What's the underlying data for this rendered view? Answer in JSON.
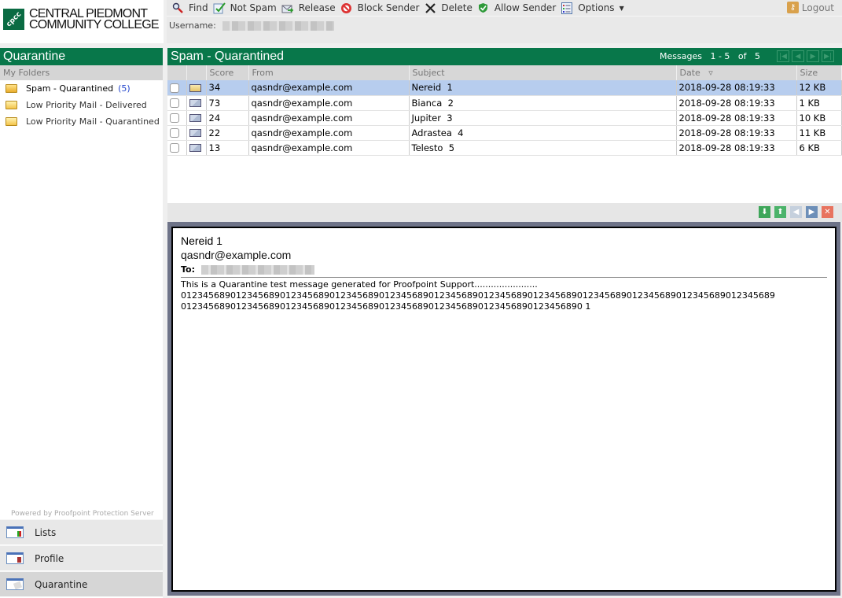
{
  "logo": {
    "mark": "cpcc",
    "line1": "CENTRAL PIEDMONT",
    "line2": "COMMUNITY COLLEGE"
  },
  "toolbar": {
    "buttons": [
      {
        "label": "Find",
        "icon": "magnifier-icon"
      },
      {
        "label": "Not Spam",
        "icon": "notepad-check-icon"
      },
      {
        "label": "Release",
        "icon": "envelope-arrow-icon"
      },
      {
        "label": "Block Sender",
        "icon": "block-icon"
      },
      {
        "label": "Delete",
        "icon": "x-icon"
      },
      {
        "label": "Allow Sender",
        "icon": "shield-check-icon"
      },
      {
        "label": "Options",
        "icon": "list-icon"
      }
    ],
    "logout": "Logout",
    "username_label": "Username:"
  },
  "sidebar": {
    "title": "Quarantine",
    "subtitle": "My Folders",
    "folders": [
      {
        "label": "Spam - Quarantined",
        "count": "(5)",
        "active": true
      },
      {
        "label": "Low Priority Mail - Delivered",
        "count": null,
        "active": false
      },
      {
        "label": "Low Priority Mail - Quarantined",
        "count": null,
        "active": false
      }
    ],
    "powered_by": "Powered by Proofpoint Protection Server",
    "nav": [
      {
        "label": "Lists"
      },
      {
        "label": "Profile"
      },
      {
        "label": "Quarantine"
      }
    ]
  },
  "main": {
    "title": "Spam - Quarantined",
    "messages_label": "Messages",
    "range": "1 - 5",
    "of": "of",
    "total": "5",
    "columns": [
      "",
      "",
      "Score",
      "From",
      "Subject",
      "Date",
      "Size"
    ],
    "sort_indicator": "▿",
    "rows": [
      {
        "score": "34",
        "from": "qasndr@example.com",
        "subject": "Nereid  1",
        "date": "2018-09-28 08:19:33",
        "size": "12 KB"
      },
      {
        "score": "73",
        "from": "qasndr@example.com",
        "subject": "Bianca  2",
        "date": "2018-09-28 08:19:33",
        "size": "1 KB"
      },
      {
        "score": "24",
        "from": "qasndr@example.com",
        "subject": "Jupiter  3",
        "date": "2018-09-28 08:19:33",
        "size": "10 KB"
      },
      {
        "score": "22",
        "from": "qasndr@example.com",
        "subject": "Adrastea  4",
        "date": "2018-09-28 08:19:33",
        "size": "11 KB"
      },
      {
        "score": "13",
        "from": "qasndr@example.com",
        "subject": "Telesto  5",
        "date": "2018-09-28 08:19:33",
        "size": "6 KB"
      }
    ]
  },
  "preview": {
    "subject": "Nereid  1",
    "from": "qasndr@example.com",
    "to_label": "To:",
    "body_line1": "This is a Quarantine test message generated for Proofpoint Support.......................",
    "body_line2": "012345689012345689012345689012345689012345689012345689012345689012345689012345689012345689012345689012345689",
    "body_line3": "0123456890123456890123456890123456890123456890123456890123456890123456890 1"
  },
  "colors": {
    "brand_green": "#08774a",
    "selected_row": "#b7cdee",
    "preview_frame": "#6e7388"
  }
}
